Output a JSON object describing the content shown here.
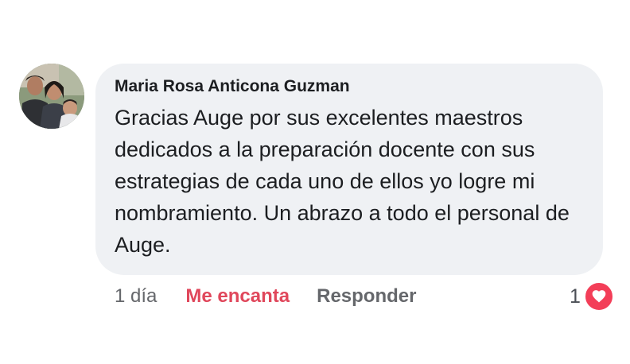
{
  "comment": {
    "author": "Maria Rosa Anticona Guzman",
    "text": "Gracias Auge por sus excelentes maestros dedicados a la preparación docente con sus estrategias de cada uno de ellos yo logre mi nombramiento. Un abrazo a todo el personal de Auge."
  },
  "actions": {
    "timestamp": "1 día",
    "reaction_label": "Me encanta",
    "reply_label": "Responder"
  },
  "reactions": {
    "count": "1",
    "icon": "heart-icon",
    "color": "#f33e58"
  },
  "colors": {
    "bubble": "#eff1f4",
    "reaction_text": "#e0475b",
    "secondary_text": "#65676b"
  }
}
